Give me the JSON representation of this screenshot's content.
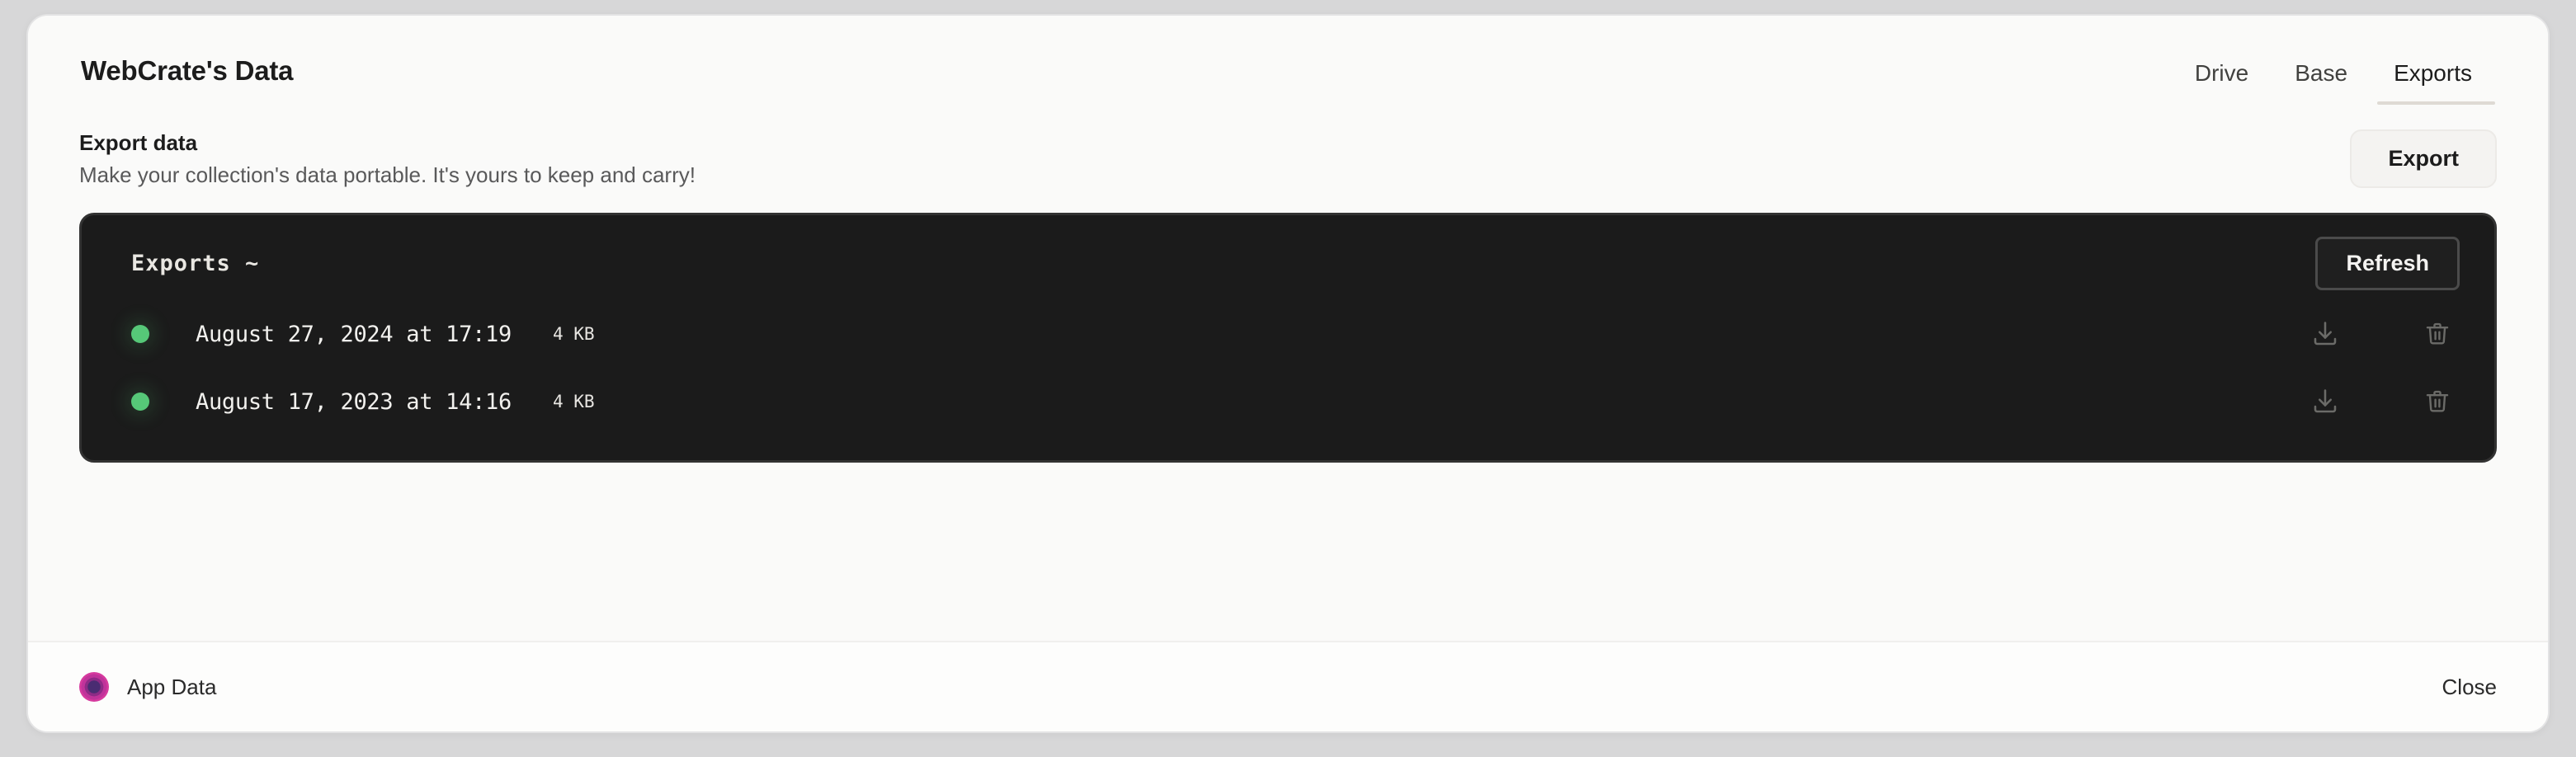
{
  "window": {
    "title": "WebCrate's Data"
  },
  "tabs": [
    {
      "label": "Drive",
      "active": false
    },
    {
      "label": "Base",
      "active": false
    },
    {
      "label": "Exports",
      "active": true
    }
  ],
  "export_section": {
    "heading": "Export data",
    "subtext": "Make your collection's data portable. It's yours to keep and carry!",
    "button_label": "Export"
  },
  "exports_panel": {
    "title": "Exports ~",
    "refresh_label": "Refresh",
    "rows": [
      {
        "status": "ready",
        "status_color": "#56c878",
        "date": "August 27, 2024 at 17:19",
        "size": "4 KB",
        "download_icon": "download-icon",
        "delete_icon": "trash-icon"
      },
      {
        "status": "ready",
        "status_color": "#56c878",
        "date": "August 17, 2023 at 14:16",
        "size": "4 KB",
        "download_icon": "download-icon",
        "delete_icon": "trash-icon"
      }
    ]
  },
  "footer": {
    "app_label": "App Data",
    "app_icon": "app-data-circle-icon",
    "close_label": "Close"
  },
  "colors": {
    "page_background": "#d7d7d8",
    "card_background": "#fafaf9",
    "panel_background": "#1b1b1b",
    "panel_border": "#323232",
    "active_tab_underline": "#dedad4",
    "status_green": "#56c878",
    "app_icon_magenta": "#d933a0",
    "app_icon_core": "#4a2c72"
  }
}
